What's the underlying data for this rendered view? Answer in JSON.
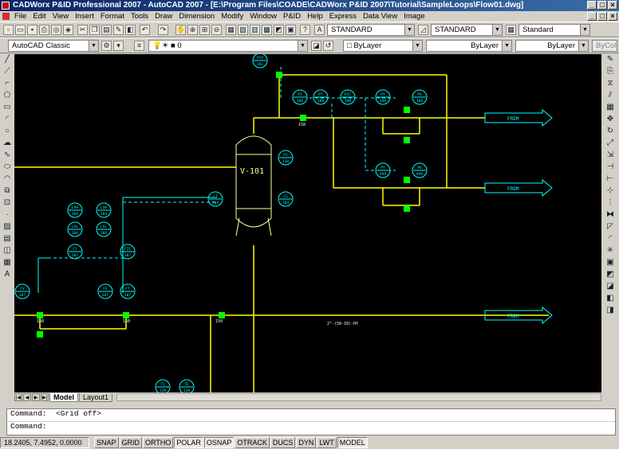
{
  "window": {
    "title": "CADWorx P&ID Professional 2007 - AutoCAD 2007 - [E:\\Program Files\\COADE\\CADWorx P&ID 2007\\Tutorial\\SampleLoops\\Flow01.dwg]"
  },
  "menubar": {
    "items": [
      "File",
      "Edit",
      "View",
      "Insert",
      "Format",
      "Tools",
      "Draw",
      "Dimension",
      "Modify",
      "Window",
      "P&ID",
      "Help",
      "Express",
      "Data View",
      "Image"
    ]
  },
  "toolbar1": {
    "text_style": "STANDARD",
    "dim_style": "STANDARD",
    "table_style": "Standard"
  },
  "toolbar2": {
    "workspace": "AutoCAD Classic",
    "layer": "0",
    "color": "ByLayer",
    "linetype": "ByLayer",
    "lineweight": "ByLayer",
    "plotstyle": "ByColor"
  },
  "drawing": {
    "vessel_label": "V-101",
    "frdm_label": "FRDM",
    "line_spec": "2\"-(50-10)-Hf",
    "pipe_size_label": "150",
    "instruments": [
      {
        "tag": "PCV",
        "num": "101"
      },
      {
        "tag": "PI",
        "num": "108"
      },
      {
        "tag": "PT",
        "num": "108"
      },
      {
        "tag": "PIC",
        "num": "108"
      },
      {
        "tag": "PY",
        "num": "108"
      },
      {
        "tag": "PV",
        "num": "108"
      },
      {
        "tag": "PI",
        "num": "110"
      },
      {
        "tag": "PY",
        "num": "999"
      },
      {
        "tag": "PV",
        "num": "999"
      },
      {
        "tag": "LT",
        "num": "104"
      },
      {
        "tag": "LG",
        "num": "104"
      },
      {
        "tag": "LAH",
        "num": "104"
      },
      {
        "tag": "LSH",
        "num": "104"
      },
      {
        "tag": "LAL",
        "num": "104"
      },
      {
        "tag": "LSL",
        "num": "104"
      },
      {
        "tag": "FI",
        "num": "107"
      },
      {
        "tag": "FIC",
        "num": "107"
      },
      {
        "tag": "FV",
        "num": "107"
      },
      {
        "tag": "FE",
        "num": "107"
      },
      {
        "tag": "FT",
        "num": "107"
      },
      {
        "tag": "TI",
        "num": "120"
      },
      {
        "tag": "TE",
        "num": "120"
      }
    ]
  },
  "tabs": {
    "model": "Model",
    "layout1": "Layout1"
  },
  "command": {
    "line1": "Command:  <Grid off>",
    "line2": "Command:"
  },
  "statusbar": {
    "coords": "18.2405, 7.4952, 0.0000",
    "toggles": [
      {
        "label": "SNAP",
        "on": false
      },
      {
        "label": "GRID",
        "on": false
      },
      {
        "label": "ORTHO",
        "on": false
      },
      {
        "label": "POLAR",
        "on": true
      },
      {
        "label": "OSNAP",
        "on": true
      },
      {
        "label": "OTRACK",
        "on": false
      },
      {
        "label": "DUCS",
        "on": false
      },
      {
        "label": "DYN",
        "on": false
      },
      {
        "label": "LWT",
        "on": false
      },
      {
        "label": "MODEL",
        "on": true
      }
    ]
  },
  "colors": {
    "background": "#000000",
    "pipe": "#ffff00",
    "instrument": "#00ffff",
    "vessel": "#ffff99",
    "valve": "#00ff00",
    "flow_arrow": "#00ffff"
  }
}
